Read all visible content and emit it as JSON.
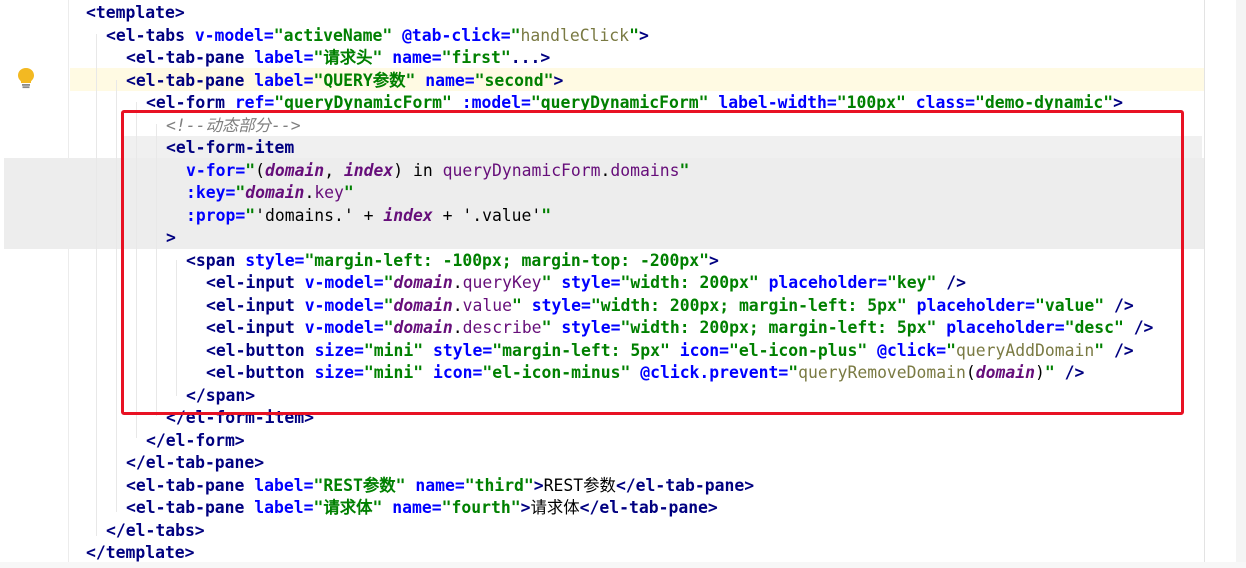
{
  "editor": {
    "lines": [
      [
        [
          "t",
          "<template"
        ],
        [
          "t",
          ">"
        ]
      ],
      [
        [
          "t",
          "<el-tabs "
        ],
        [
          "a",
          "v-model="
        ],
        [
          "s",
          "\"activeName\" "
        ],
        [
          "a",
          "@tab-click="
        ],
        [
          "s",
          "\""
        ],
        [
          "m",
          "handleClick"
        ],
        [
          "s",
          "\""
        ],
        [
          "t",
          ">"
        ]
      ],
      [
        [
          "t",
          "<el-tab-pane "
        ],
        [
          "a",
          "label="
        ],
        [
          "s",
          "\"请求头\" "
        ],
        [
          "a",
          "name="
        ],
        [
          "s",
          "\"first\""
        ],
        [
          "t",
          "...>"
        ]
      ],
      [
        [
          "t",
          "<el-tab-pane "
        ],
        [
          "a",
          "label="
        ],
        [
          "s",
          "\"QUERY参数\" "
        ],
        [
          "a",
          "name="
        ],
        [
          "s",
          "\"second\""
        ],
        [
          "t",
          ">"
        ]
      ],
      [
        [
          "t",
          "<el-form "
        ],
        [
          "a",
          "ref="
        ],
        [
          "s",
          "\"queryDynamicForm\" "
        ],
        [
          "a",
          ":model="
        ],
        [
          "s",
          "\"queryDynamicForm\" "
        ],
        [
          "a",
          "label-width="
        ],
        [
          "s",
          "\"100px\" "
        ],
        [
          "a",
          "class="
        ],
        [
          "s",
          "\"demo-dynamic\""
        ],
        [
          "t",
          ">"
        ]
      ],
      [
        [
          "c",
          "<!--动态部分-->"
        ]
      ],
      [
        [
          "t",
          "<el-form-item"
        ]
      ],
      [
        [
          "a",
          "v-for="
        ],
        [
          "s",
          "\""
        ],
        [
          "p",
          "("
        ],
        [
          "v",
          "domain"
        ],
        [
          "p",
          ", "
        ],
        [
          "v",
          "index"
        ],
        [
          "p",
          ") "
        ],
        [
          "n",
          "in "
        ],
        [
          "f",
          "queryDynamicForm"
        ],
        [
          "p",
          "."
        ],
        [
          "f",
          "domains"
        ],
        [
          "s",
          "\""
        ]
      ],
      [
        [
          "a",
          ":key="
        ],
        [
          "s",
          "\""
        ],
        [
          "v",
          "domain"
        ],
        [
          "p",
          "."
        ],
        [
          "f",
          "key"
        ],
        [
          "s",
          "\""
        ]
      ],
      [
        [
          "a",
          ":prop="
        ],
        [
          "s",
          "\""
        ],
        [
          "p",
          "'domains.' + "
        ],
        [
          "v",
          "index"
        ],
        [
          "p",
          " + '.value'"
        ],
        [
          "s",
          "\""
        ]
      ],
      [
        [
          "t",
          ">"
        ]
      ],
      [
        [
          "t",
          "<span "
        ],
        [
          "a",
          "style="
        ],
        [
          "s",
          "\"margin-left: -100px; margin-top: -200px\""
        ],
        [
          "t",
          ">"
        ]
      ],
      [
        [
          "t",
          "<el-input "
        ],
        [
          "a",
          "v-model="
        ],
        [
          "s",
          "\""
        ],
        [
          "v",
          "domain"
        ],
        [
          "p",
          "."
        ],
        [
          "f",
          "queryKey"
        ],
        [
          "s",
          "\" "
        ],
        [
          "a",
          "style="
        ],
        [
          "s",
          "\"width: 200px\" "
        ],
        [
          "a",
          "placeholder="
        ],
        [
          "s",
          "\"key\" "
        ],
        [
          "t",
          "/>"
        ]
      ],
      [
        [
          "t",
          "<el-input "
        ],
        [
          "a",
          "v-model="
        ],
        [
          "s",
          "\""
        ],
        [
          "v",
          "domain"
        ],
        [
          "p",
          "."
        ],
        [
          "f",
          "value"
        ],
        [
          "s",
          "\" "
        ],
        [
          "a",
          "style="
        ],
        [
          "s",
          "\"width: 200px; margin-left: 5px\" "
        ],
        [
          "a",
          "placeholder="
        ],
        [
          "s",
          "\"value\" "
        ],
        [
          "t",
          "/>"
        ]
      ],
      [
        [
          "t",
          "<el-input "
        ],
        [
          "a",
          "v-model="
        ],
        [
          "s",
          "\""
        ],
        [
          "v",
          "domain"
        ],
        [
          "p",
          "."
        ],
        [
          "f",
          "describe"
        ],
        [
          "s",
          "\" "
        ],
        [
          "a",
          "style="
        ],
        [
          "s",
          "\"width: 200px; margin-left: 5px\" "
        ],
        [
          "a",
          "placeholder="
        ],
        [
          "s",
          "\"desc\" "
        ],
        [
          "t",
          "/>"
        ]
      ],
      [
        [
          "t",
          "<el-button "
        ],
        [
          "a",
          "size="
        ],
        [
          "s",
          "\"mini\" "
        ],
        [
          "a",
          "style="
        ],
        [
          "s",
          "\"margin-left: 5px\" "
        ],
        [
          "a",
          "icon="
        ],
        [
          "s",
          "\"el-icon-plus\" "
        ],
        [
          "a",
          "@click="
        ],
        [
          "s",
          "\""
        ],
        [
          "m",
          "queryAddDomain"
        ],
        [
          "s",
          "\" "
        ],
        [
          "t",
          "/>"
        ]
      ],
      [
        [
          "t",
          "<el-button "
        ],
        [
          "a",
          "size="
        ],
        [
          "s",
          "\"mini\" "
        ],
        [
          "a",
          "icon="
        ],
        [
          "s",
          "\"el-icon-minus\" "
        ],
        [
          "a",
          "@click.prevent="
        ],
        [
          "s",
          "\""
        ],
        [
          "m",
          "queryRemoveDomain"
        ],
        [
          "p",
          "("
        ],
        [
          "v",
          "domain"
        ],
        [
          "p",
          ")"
        ],
        [
          "s",
          "\" "
        ],
        [
          "t",
          "/>"
        ]
      ],
      [
        [
          "t",
          "</span>"
        ]
      ],
      [
        [
          "t",
          "</el-form-item>"
        ]
      ],
      [
        [
          "t",
          "</el-form>"
        ]
      ],
      [
        [
          "t",
          "</el-tab-pane>"
        ]
      ],
      [
        [
          "t",
          "<el-tab-pane "
        ],
        [
          "a",
          "label="
        ],
        [
          "s",
          "\"REST参数\" "
        ],
        [
          "a",
          "name="
        ],
        [
          "s",
          "\"third\""
        ],
        [
          "t",
          ">"
        ],
        [
          "n",
          "REST参数"
        ],
        [
          "t",
          "</el-tab-pane>"
        ]
      ],
      [
        [
          "t",
          "<el-tab-pane "
        ],
        [
          "a",
          "label="
        ],
        [
          "s",
          "\"请求体\" "
        ],
        [
          "a",
          "name="
        ],
        [
          "s",
          "\"fourth\""
        ],
        [
          "t",
          ">"
        ],
        [
          "n",
          "请求体"
        ],
        [
          "t",
          "</el-tab-pane>"
        ]
      ],
      [
        [
          "t",
          "</el-tabs>"
        ]
      ],
      [
        [
          "t",
          "</template>"
        ]
      ]
    ],
    "icons": {
      "gutter": "lightbulb-icon"
    },
    "colors": {
      "highlight_box": "#e81123",
      "tag": "#000080",
      "attribute": "#0000ff",
      "string": "#008000",
      "comment": "#808080"
    }
  }
}
